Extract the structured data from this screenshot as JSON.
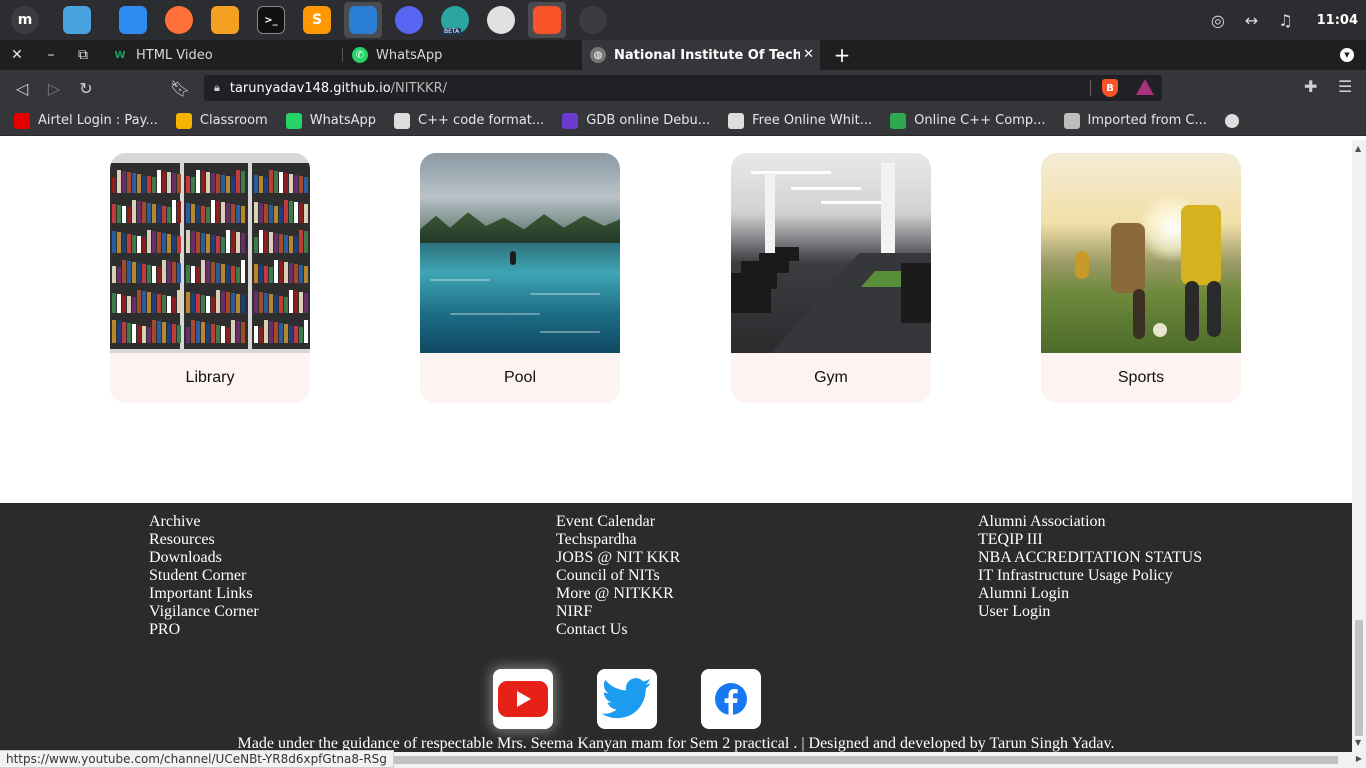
{
  "taskbar": {
    "apps": [
      {
        "name": "mint-menu",
        "color": "#3a3c40",
        "glyph": "m"
      },
      {
        "name": "files",
        "color": "#4aa3df",
        "glyph": ""
      },
      {
        "name": "finder",
        "color": "#2f8cf0",
        "glyph": ""
      },
      {
        "name": "firefox",
        "color": "#ff7139",
        "glyph": ""
      },
      {
        "name": "genie",
        "color": "#f4a020",
        "glyph": ""
      },
      {
        "name": "terminal",
        "color": "#111111",
        "glyph": ">_"
      },
      {
        "name": "sublime-text",
        "color": "#ff9800",
        "glyph": "S"
      },
      {
        "name": "vscode",
        "color": "#2a7fd4",
        "glyph": ""
      },
      {
        "name": "discord",
        "color": "#5865f2",
        "glyph": ""
      },
      {
        "name": "edge-beta",
        "color": "#2aa5a0",
        "glyph": ""
      },
      {
        "name": "chrome",
        "color": "#e0e0e0",
        "glyph": ""
      },
      {
        "name": "brave",
        "color": "#fb542b",
        "glyph": ""
      },
      {
        "name": "obs",
        "color": "#3a3c40",
        "glyph": ""
      }
    ],
    "edge_badge": "BETA",
    "clock": "11:04"
  },
  "tabs": [
    {
      "title": "HTML Video",
      "favicon": "W",
      "favicon_color": "#1aa260"
    },
    {
      "title": "WhatsApp",
      "favicon": "",
      "favicon_color": "#25d366"
    },
    {
      "title": "National Institute Of Technolo",
      "favicon": "",
      "favicon_color": "#888888",
      "active": true
    }
  ],
  "address": {
    "host": "tarunyadav148.github.io",
    "path": "/NITKKR/"
  },
  "bookmarks": [
    {
      "label": "Airtel Login : Pay...",
      "color": "#e40000"
    },
    {
      "label": "Classroom",
      "color": "#f6b400"
    },
    {
      "label": "WhatsApp",
      "color": "#25d366"
    },
    {
      "label": "C++ code format...",
      "color": "#dddddd"
    },
    {
      "label": "GDB online Debu...",
      "color": "#6c3bd1"
    },
    {
      "label": "Free Online Whit...",
      "color": "#dddddd"
    },
    {
      "label": "Online C++ Comp...",
      "color": "#2fa84f"
    },
    {
      "label": "Imported from C...",
      "color": "#bdbdbd"
    }
  ],
  "facilities": [
    {
      "label": "Library"
    },
    {
      "label": "Pool"
    },
    {
      "label": "Gym"
    },
    {
      "label": "Sports"
    }
  ],
  "footer": {
    "col1": [
      "Archive",
      "Resources",
      "Downloads",
      "Student Corner",
      "Important Links",
      "Vigilance Corner",
      "PRO"
    ],
    "col2": [
      "Event Calendar",
      "Techspardha",
      "JOBS @ NIT KKR",
      "Council of NITs",
      "More @ NITKKR",
      "NIRF",
      "Contact Us"
    ],
    "col3": [
      "Alumni Association",
      "TEQIP III",
      "NBA ACCREDITATION STATUS",
      "IT Infrastructure Usage Policy",
      "Alumni Login",
      "User Login"
    ],
    "social": [
      {
        "name": "youtube",
        "color": "#e62117"
      },
      {
        "name": "twitter",
        "color": "#1d9bf0"
      },
      {
        "name": "facebook",
        "color": "#1877f2"
      }
    ],
    "credit": "Made under the guidance of respectable Mrs. Seema Kanyan mam for Sem 2 practical . | Designed and developed by Tarun Singh Yadav."
  },
  "status_url": "https://www.youtube.com/channel/UCeNBt-YR8d6xpfGtna8-RSg"
}
